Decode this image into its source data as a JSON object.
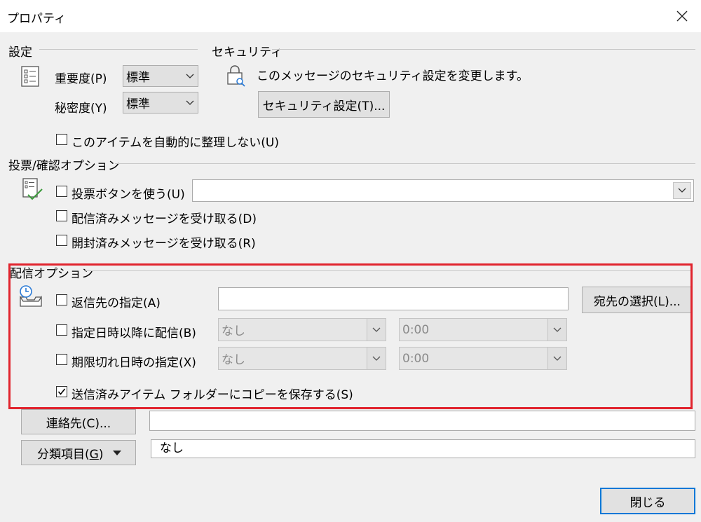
{
  "window": {
    "title": "プロパティ"
  },
  "settings": {
    "section_label": "設定",
    "importance_label": "重要度(P)",
    "importance_value": "標準",
    "sensitivity_label": "秘密度(Y)",
    "sensitivity_value": "標準",
    "do_not_autoarchive_label": "このアイテムを自動的に整理しない(U)",
    "do_not_autoarchive_checked": false
  },
  "security": {
    "section_label": "セキュリティ",
    "description": "このメッセージのセキュリティ設定を変更します。",
    "settings_button_label": "セキュリティ設定(T)..."
  },
  "voting": {
    "section_label": "投票/確認オプション",
    "use_voting_buttons_label": "投票ボタンを使う(U)",
    "use_voting_buttons_checked": false,
    "voting_buttons_value": "",
    "delivery_receipt_label": "配信済みメッセージを受け取る(D)",
    "delivery_receipt_checked": false,
    "read_receipt_label": "開封済みメッセージを受け取る(R)",
    "read_receipt_checked": false
  },
  "delivery": {
    "section_label": "配信オプション",
    "reply_to_label": "返信先の指定(A)",
    "reply_to_checked": false,
    "reply_to_value": "",
    "select_names_button_label": "宛先の選択(L)...",
    "deliver_after_label": "指定日時以降に配信(B)",
    "deliver_after_checked": false,
    "deliver_after_date": "なし",
    "deliver_after_time": "0:00",
    "expires_after_label": "期限切れ日時の指定(X)",
    "expires_after_checked": false,
    "expires_after_date": "なし",
    "expires_after_time": "0:00",
    "save_copy_label": "送信済みアイテム フォルダーにコピーを保存する(S)",
    "save_copy_checked": true
  },
  "contacts": {
    "button_label": "連絡先(C)...",
    "value": ""
  },
  "categories": {
    "button_label_pre": "分類項目(",
    "button_label_key": "G",
    "button_label_post": ")",
    "value": "なし"
  },
  "footer": {
    "close_button_label": "閉じる"
  },
  "colors": {
    "highlight_border": "#e1232d",
    "dialog_bg": "#f0f0f0",
    "default_button_border": "#0078d7"
  }
}
